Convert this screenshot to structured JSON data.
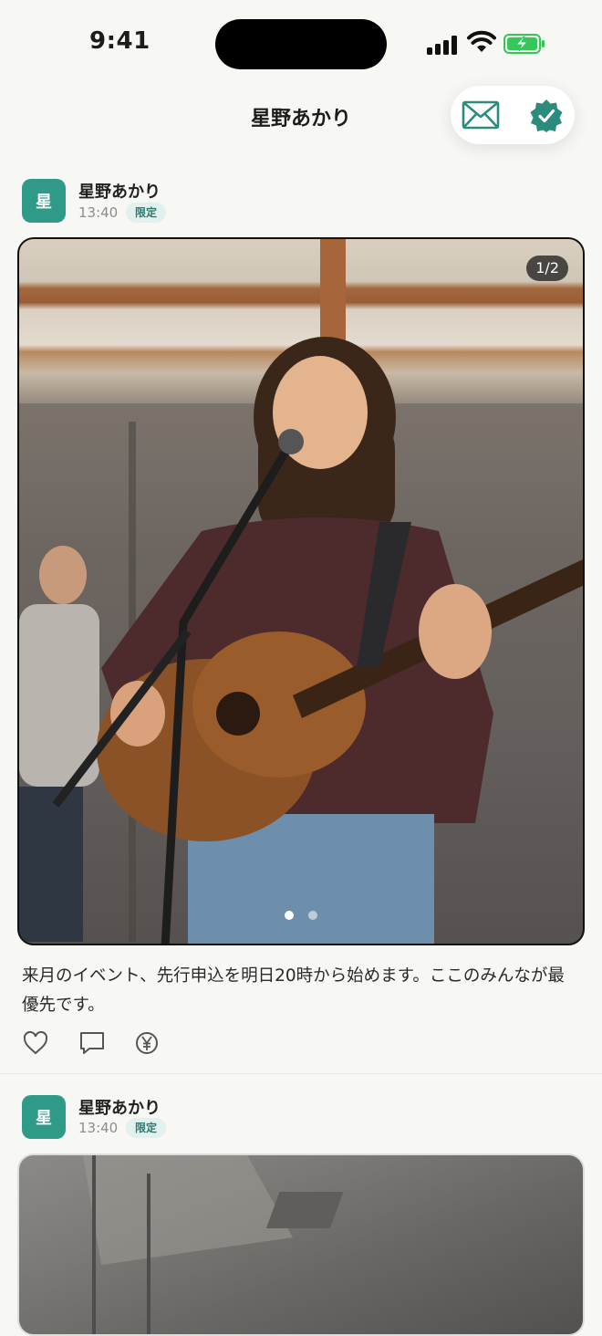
{
  "status_bar": {
    "time": "9:41",
    "icons": [
      "signal-icon",
      "wifi-icon",
      "battery-charging-icon"
    ]
  },
  "header": {
    "title": "星野あかり",
    "actions": [
      "mail-icon",
      "verified-badge-icon"
    ]
  },
  "posts": [
    {
      "avatar_letter": "星",
      "author": "星野あかり",
      "time": "13:40",
      "badge": "限定",
      "image_counter": "1/2",
      "image_dots": 2,
      "active_dot": 0,
      "text": "来月のイベント、先行申込を明日20時から始めます。ここのみんなが最優先です。",
      "actions": [
        "heart-icon",
        "comment-icon",
        "tip-yen-icon"
      ]
    },
    {
      "avatar_letter": "星",
      "author": "星野あかり",
      "time": "13:40",
      "badge": "限定"
    }
  ],
  "colors": {
    "accent": "#2f9a87",
    "badge_bg": "#e2f0ee",
    "background": "#f7f7f4"
  }
}
